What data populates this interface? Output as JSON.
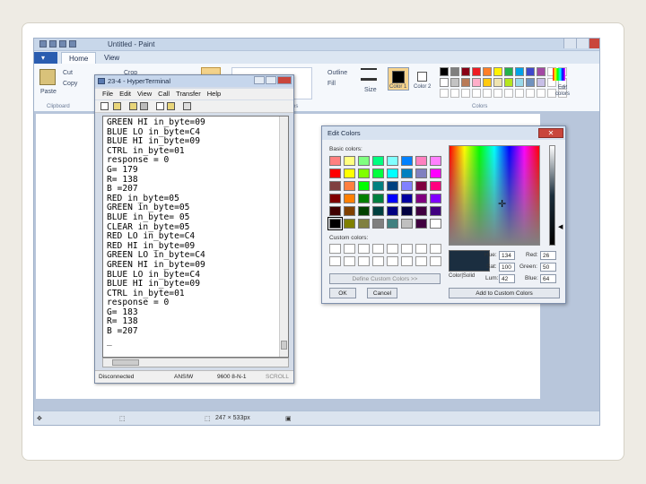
{
  "paint": {
    "title": "Untitled - Paint",
    "tabs": {
      "file": "",
      "home": "Home",
      "view": "View"
    },
    "clipboard": {
      "paste": "Paste",
      "cut": "Cut",
      "copy": "Copy",
      "group": "Clipboard"
    },
    "image": {
      "crop": "Crop"
    },
    "shapes": {
      "outline": "Outline",
      "fill": "Fill",
      "group_partial": "es"
    },
    "size_label": "Size",
    "color1": "Color 1",
    "color2": "Color 2",
    "colors_group": "Colors",
    "edit_colors": "Edit colors",
    "palette_row1": [
      "#000000",
      "#7f7f7f",
      "#880015",
      "#ed1c24",
      "#ff7f27",
      "#fff200",
      "#22b14c",
      "#00a2e8",
      "#3f48cc",
      "#a349a4"
    ],
    "palette_row2": [
      "#ffffff",
      "#c3c3c3",
      "#b97a57",
      "#ffaec9",
      "#ffc90e",
      "#efe4b0",
      "#b5e61d",
      "#99d9ea",
      "#7092be",
      "#c8bfe7"
    ],
    "status": {
      "size": "247 × 533px"
    }
  },
  "hyperterminal": {
    "title": "23-4 - HyperTerminal",
    "menu": [
      "File",
      "Edit",
      "View",
      "Call",
      "Transfer",
      "Help"
    ],
    "lines": [
      "GREEN HI in_byte=09",
      "BLUE LO in_byte=C4",
      "BLUE HI in_byte=09",
      "CTRL in_byte=01",
      "response = 0",
      "G= 179",
      "R= 138",
      "B =207",
      "RED in_byte=05",
      "GREEN in_byte=05",
      "BLUE in_byte= 05",
      "CLEAR in_byte=05",
      "RED LO in_byte=C4",
      "RED HI in_byte=09",
      "GREEN LO in_byte=C4",
      "GREEN HI in_byte=09",
      "BLUE LO in_byte=C4",
      "BLUE HI in_byte=09",
      "CTRL in_byte=01",
      "response = 0",
      "G= 183",
      "R= 138",
      "B =207",
      "_"
    ],
    "status": {
      "connection": "Disconnected",
      "emulation": "ANSIW",
      "settings": "9600 8-N-1",
      "scroll": "SCROLL"
    }
  },
  "edit_colors": {
    "title": "Edit Colors",
    "close": "✕",
    "basic_label": "Basic colors:",
    "custom_label": "Custom colors:",
    "define_button": "Define Custom Colors >>",
    "ok": "OK",
    "cancel": "Cancel",
    "color_solid": "Color|Solid",
    "add_button": "Add to Custom Colors",
    "hue_label": "Hue:",
    "hue": "134",
    "sat_label": "Sat:",
    "sat": "100",
    "lum_label": "Lum:",
    "lum": "42",
    "red_label": "Red:",
    "red": "26",
    "green_label": "Green:",
    "green": "50",
    "blue_label": "Blue:",
    "blue": "64",
    "basic_colors": [
      "#ff8080",
      "#ffff80",
      "#80ff80",
      "#00ff80",
      "#80ffff",
      "#0080ff",
      "#ff80c0",
      "#ff80ff",
      "#ff0000",
      "#ffff00",
      "#80ff00",
      "#00ff40",
      "#00ffff",
      "#0080c0",
      "#8080c0",
      "#ff00ff",
      "#804040",
      "#ff8040",
      "#00ff00",
      "#008080",
      "#004080",
      "#8080ff",
      "#800040",
      "#ff0080",
      "#800000",
      "#ff8000",
      "#008000",
      "#008040",
      "#0000ff",
      "#0000a0",
      "#800080",
      "#8000ff",
      "#400000",
      "#804000",
      "#004000",
      "#004040",
      "#000080",
      "#000040",
      "#400040",
      "#400080",
      "#000000",
      "#808000",
      "#808040",
      "#808080",
      "#408080",
      "#c0c0c0",
      "#400040",
      "#ffffff"
    ]
  }
}
